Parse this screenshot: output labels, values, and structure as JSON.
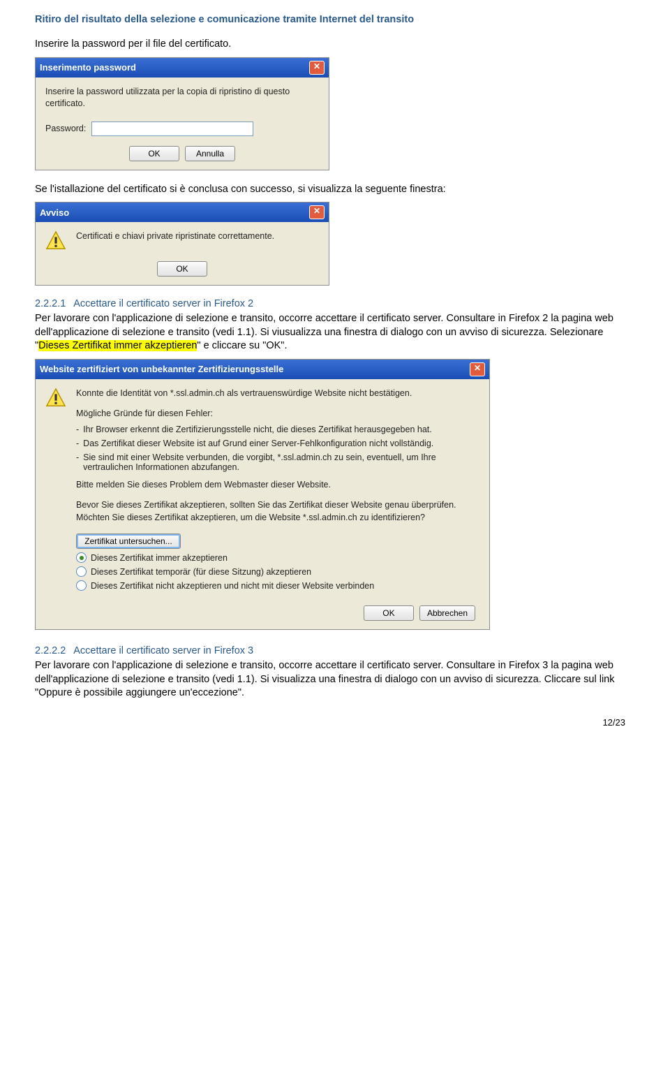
{
  "header": "Ritiro del risultato della selezione e comunicazione tramite Internet del transito",
  "intro1": "Inserire la password per il file del certificato.",
  "dialog1": {
    "title": "Inserimento password",
    "message": "Inserire la password utilizzata per la copia di ripristino di questo certificato.",
    "label": "Password:",
    "ok": "OK",
    "cancel": "Annulla"
  },
  "intro2": "Se l'istallazione del certificato si è conclusa con successo, si visualizza la seguente finestra:",
  "dialog2": {
    "title": "Avviso",
    "message": "Certificati e chiavi private ripristinate correttamente.",
    "ok": "OK"
  },
  "s221": {
    "num": "2.2.2.1",
    "title": "Accettare il certificato server in Firefox 2",
    "body_before": "Per lavorare con l'applicazione di selezione e transito, occorre accettare il certificato server. Consultare in Firefox 2 la pagina web dell'applicazione di selezione e transito (vedi 1.1). Si viusualizza una finestra di dialogo con un avviso di sicurezza. Selezionare \"",
    "highlight": "Dieses Zertifikat immer akzeptieren",
    "body_after": "\" e cliccare su \"OK\"."
  },
  "dialog3": {
    "title": "Website zertifiziert von unbekannter Zertifizierungsstelle",
    "line1": "Konnte die Identität von *.ssl.admin.ch als vertrauenswürdige Website nicht bestätigen.",
    "line2": "Mögliche Gründe für diesen Fehler:",
    "b1": "Ihr Browser erkennt die Zertifizierungsstelle nicht, die dieses Zertifikat herausgegeben hat.",
    "b2": "Das Zertifikat dieser Website ist auf Grund einer Server-Fehlkonfiguration nicht vollständig.",
    "b3": "Sie sind mit einer Website verbunden, die vorgibt, *.ssl.admin.ch zu sein, eventuell, um Ihre vertraulichen Informationen abzufangen.",
    "line3": "Bitte melden Sie dieses Problem dem Webmaster dieser Website.",
    "line4": "Bevor Sie dieses Zertifikat akzeptieren, sollten Sie das Zertifikat dieser Website genau überprüfen. Möchten Sie dieses Zertifikat akzeptieren, um die Website *.ssl.admin.ch zu identifizieren?",
    "inspect": "Zertifikat untersuchen...",
    "r1": "Dieses Zertifikat immer akzeptieren",
    "r2": "Dieses Zertifikat temporär (für diese Sitzung) akzeptieren",
    "r3": "Dieses Zertifikat nicht akzeptieren und nicht mit dieser Website verbinden",
    "ok": "OK",
    "cancel": "Abbrechen"
  },
  "s222": {
    "num": "2.2.2.2",
    "title": "Accettare il certificato server in Firefox 3",
    "body": "Per lavorare con l'applicazione di selezione e transito, occorre accettare il certificato server. Consultare in Firefox 3 la pagina web dell'applicazione di selezione e transito (vedi 1.1). Si visualizza una finestra di dialogo con un avviso di sicurezza. Cliccare sul link \"Oppure è possibile aggiungere un'eccezione\"."
  },
  "pagenum": "12/23"
}
